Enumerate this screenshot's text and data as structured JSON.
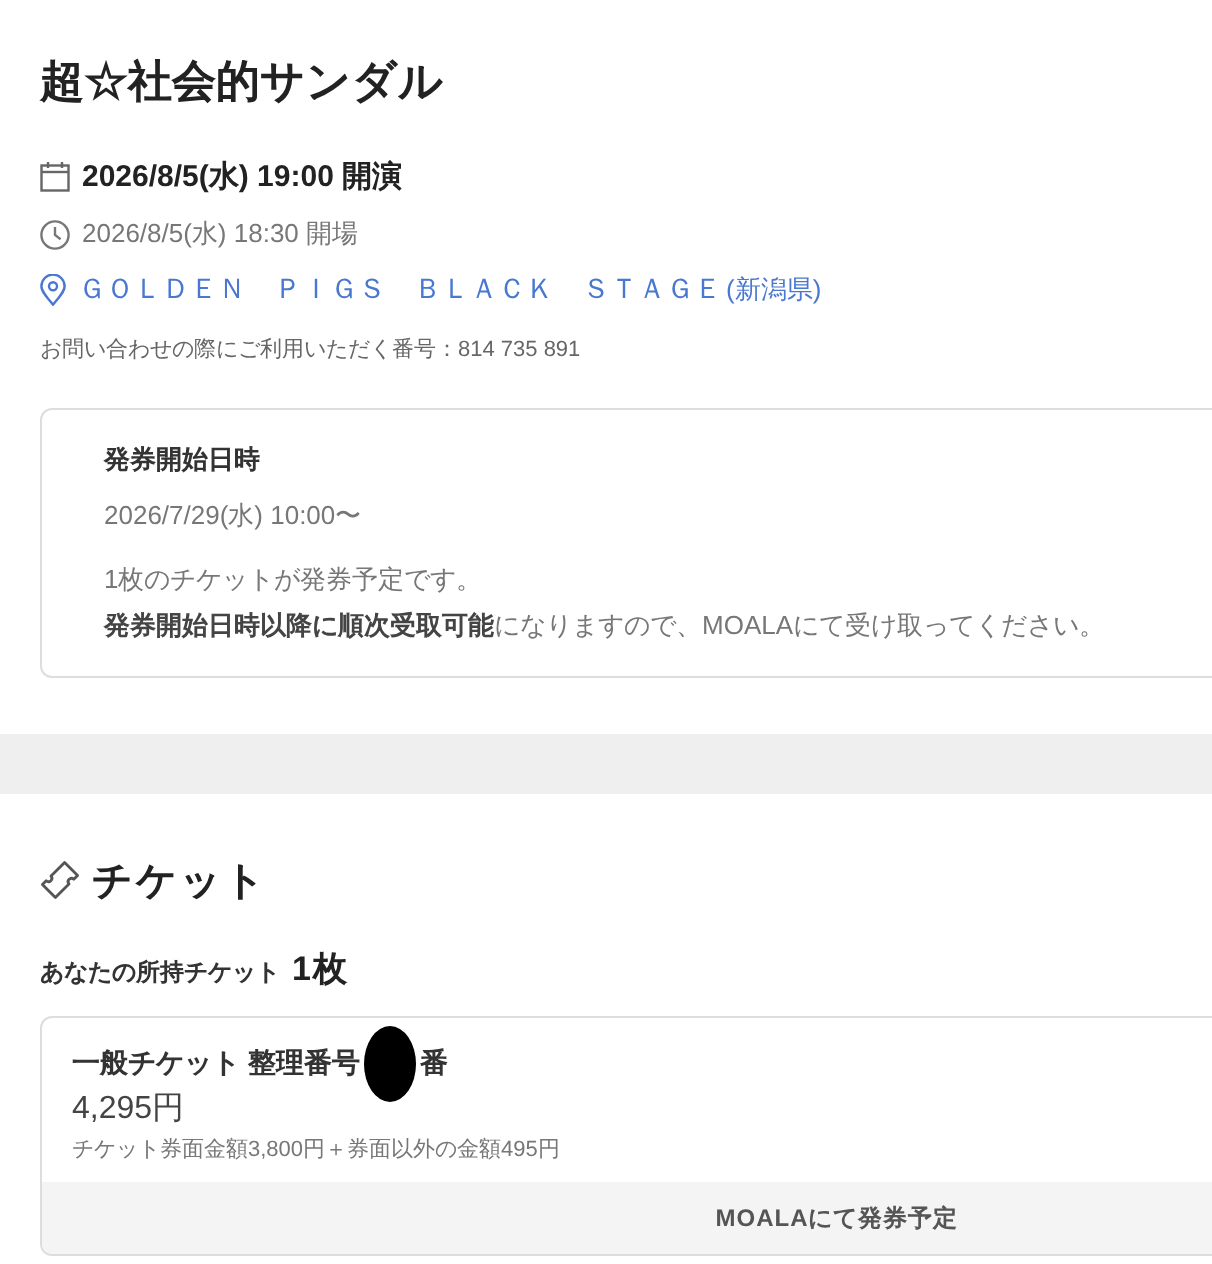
{
  "event": {
    "title": "超☆社会的サンダル",
    "performance": "2026/8/5(水) 19:00 開演",
    "doors": "2026/8/5(水) 18:30 開場",
    "venue": {
      "name": "ＧＯＬＤＥＮ　ＰＩＧＳ　ＢＬＡＣＫ　ＳＴＡＧＥ",
      "region": "(新潟県)"
    },
    "inquiry_number": "お問い合わせの際にご利用いただく番号：814 735 891"
  },
  "issue_info": {
    "heading": "発券開始日時",
    "datetime": "2026/7/29(水) 10:00〜",
    "lines": [
      "1枚のチケットが発券予定です。",
      "**発券開始日時以降に順次受取可能**になりますので、MOALAにて受け取ってください。"
    ]
  },
  "tickets_section": {
    "heading": "チケット",
    "owned_label": "あなたの所持チケット",
    "owned_count": "1枚",
    "tickets": [
      {
        "name": "一般チケット 整理番号",
        "number_redacted": true,
        "name_suffix": "番",
        "price": "4,295円",
        "breakdown": "チケット券面金額3,800円＋券面以外の金額495円",
        "status": "MOALAにて発券予定"
      }
    ]
  }
}
